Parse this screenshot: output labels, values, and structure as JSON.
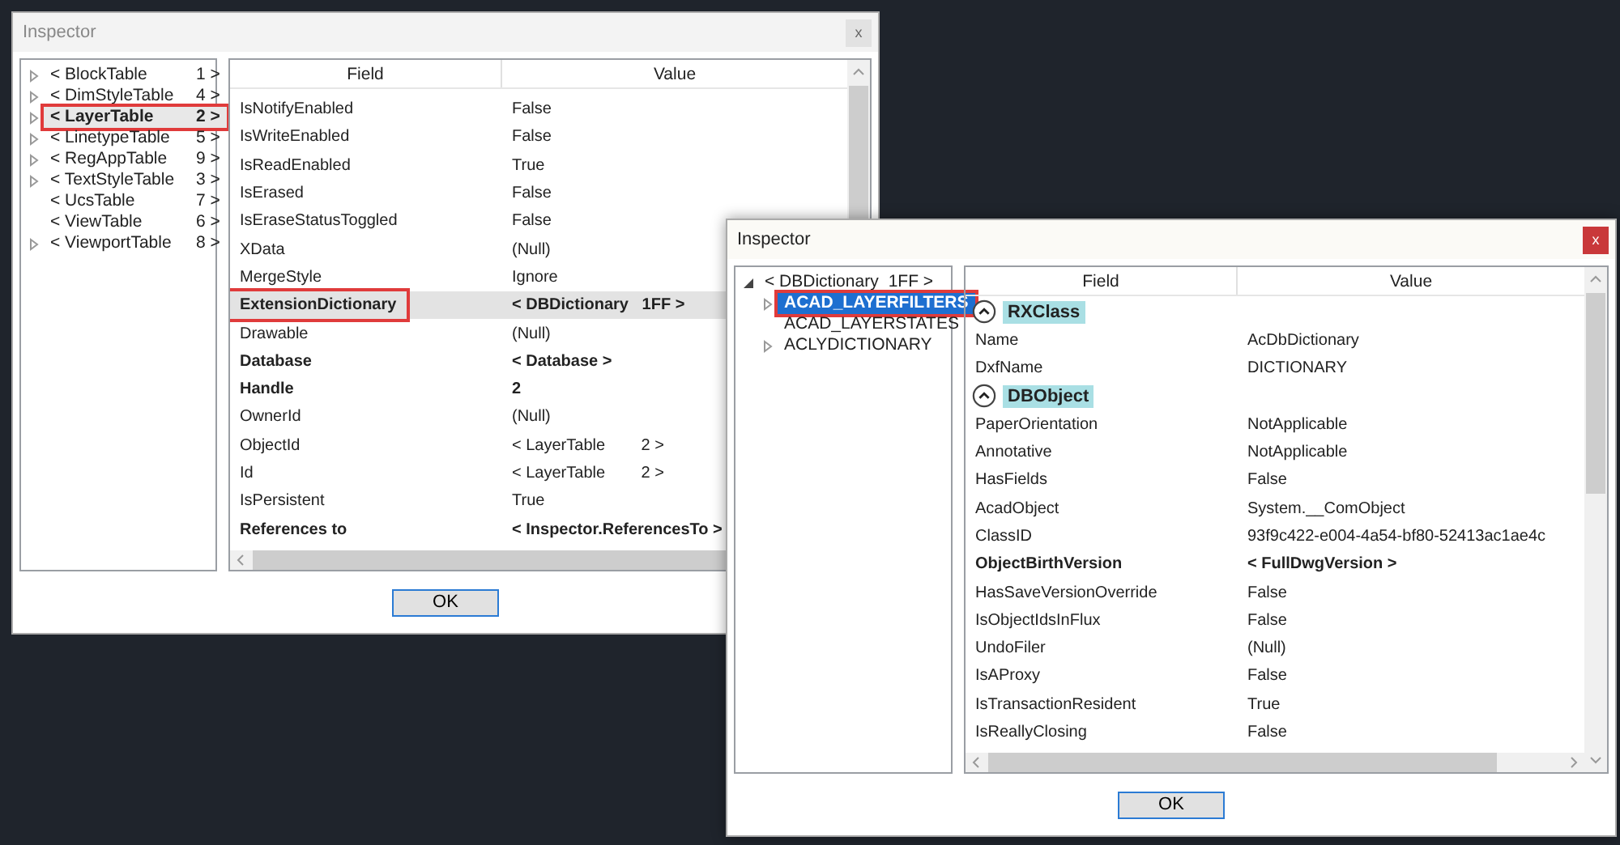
{
  "windows": [
    {
      "title": "Inspector",
      "close": "x",
      "active": false,
      "tree": [
        {
          "label": "< BlockTable",
          "count": "1 >",
          "expandable": true,
          "selected": false,
          "highlighted": false
        },
        {
          "label": "< DimStyleTable",
          "count": "4 >",
          "expandable": true,
          "selected": false,
          "highlighted": false
        },
        {
          "label": "< LayerTable",
          "count": "2 >",
          "expandable": true,
          "selected": true,
          "highlighted": true
        },
        {
          "label": "< LinetypeTable",
          "count": "5 >",
          "expandable": true,
          "selected": false,
          "highlighted": false
        },
        {
          "label": "< RegAppTable",
          "count": "9 >",
          "expandable": true,
          "selected": false,
          "highlighted": false
        },
        {
          "label": "< TextStyleTable",
          "count": "3 >",
          "expandable": true,
          "selected": false,
          "highlighted": false
        },
        {
          "label": "< UcsTable",
          "count": "7 >",
          "expandable": false,
          "selected": false,
          "highlighted": false
        },
        {
          "label": "< ViewTable",
          "count": "6 >",
          "expandable": false,
          "selected": false,
          "highlighted": false
        },
        {
          "label": "< ViewportTable",
          "count": "8 >",
          "expandable": true,
          "selected": false,
          "highlighted": false
        }
      ],
      "columns": [
        "Field",
        "Value"
      ],
      "rows": [
        {
          "kind": "property",
          "field": "IsNotifyEnabled",
          "value": "False",
          "bold": false,
          "selected": false,
          "highlighted": false
        },
        {
          "kind": "property",
          "field": "IsWriteEnabled",
          "value": "False",
          "bold": false,
          "selected": false,
          "highlighted": false
        },
        {
          "kind": "property",
          "field": "IsReadEnabled",
          "value": "True",
          "bold": false,
          "selected": false,
          "highlighted": false
        },
        {
          "kind": "property",
          "field": "IsErased",
          "value": "False",
          "bold": false,
          "selected": false,
          "highlighted": false
        },
        {
          "kind": "property",
          "field": "IsEraseStatusToggled",
          "value": "False",
          "bold": false,
          "selected": false,
          "highlighted": false
        },
        {
          "kind": "property",
          "field": "XData",
          "value": "(Null)",
          "bold": false,
          "selected": false,
          "highlighted": false
        },
        {
          "kind": "property",
          "field": "MergeStyle",
          "value": "Ignore",
          "bold": false,
          "selected": false,
          "highlighted": false
        },
        {
          "kind": "property",
          "field": "ExtensionDictionary",
          "value": "< DBDictionary   1FF >",
          "bold": true,
          "selected": true,
          "highlighted": true
        },
        {
          "kind": "property",
          "field": "Drawable",
          "value": "(Null)",
          "bold": false,
          "selected": false,
          "highlighted": false
        },
        {
          "kind": "property",
          "field": "Database",
          "value": "< Database >",
          "bold": true,
          "selected": false,
          "highlighted": false
        },
        {
          "kind": "property",
          "field": "Handle",
          "value": "2",
          "bold": true,
          "selected": false,
          "highlighted": false
        },
        {
          "kind": "property",
          "field": "OwnerId",
          "value": "(Null)",
          "bold": false,
          "selected": false,
          "highlighted": false
        },
        {
          "kind": "property",
          "field": "ObjectId",
          "value": "< LayerTable        2 >",
          "bold": false,
          "selected": false,
          "highlighted": false
        },
        {
          "kind": "property",
          "field": "Id",
          "value": "< LayerTable        2 >",
          "bold": false,
          "selected": false,
          "highlighted": false
        },
        {
          "kind": "property",
          "field": "IsPersistent",
          "value": "True",
          "bold": false,
          "selected": false,
          "highlighted": false
        },
        {
          "kind": "property",
          "field": "References to",
          "value": "< Inspector.ReferencesTo >",
          "bold": true,
          "selected": false,
          "highlighted": false
        }
      ],
      "ok": "OK"
    },
    {
      "title": "Inspector",
      "close": "x",
      "active": true,
      "tree": [
        {
          "label": "< DBDictionary",
          "count": "1FF >",
          "expandable": true,
          "expanded": true,
          "selected": false,
          "highlighted": false,
          "children": [
            {
              "label": "ACAD_LAYERFILTERS",
              "expandable": true,
              "selected": true,
              "highlighted": true
            },
            {
              "label": "ACAD_LAYERSTATES",
              "expandable": false,
              "selected": false,
              "highlighted": false
            },
            {
              "label": "ACLYDICTIONARY",
              "expandable": true,
              "selected": false,
              "highlighted": false
            }
          ]
        }
      ],
      "columns": [
        "Field",
        "Value"
      ],
      "rows": [
        {
          "kind": "section",
          "field": "RXClass"
        },
        {
          "kind": "property",
          "field": "Name",
          "value": "AcDbDictionary",
          "bold": false,
          "selected": false,
          "highlighted": false
        },
        {
          "kind": "property",
          "field": "DxfName",
          "value": "DICTIONARY",
          "bold": false,
          "selected": false,
          "highlighted": false
        },
        {
          "kind": "section",
          "field": "DBObject"
        },
        {
          "kind": "property",
          "field": "PaperOrientation",
          "value": "NotApplicable",
          "bold": false,
          "selected": false,
          "highlighted": false
        },
        {
          "kind": "property",
          "field": "Annotative",
          "value": "NotApplicable",
          "bold": false,
          "selected": false,
          "highlighted": false
        },
        {
          "kind": "property",
          "field": "HasFields",
          "value": "False",
          "bold": false,
          "selected": false,
          "highlighted": false
        },
        {
          "kind": "property",
          "field": "AcadObject",
          "value": "System.__ComObject",
          "bold": false,
          "selected": false,
          "highlighted": false
        },
        {
          "kind": "property",
          "field": "ClassID",
          "value": "93f9c422-e004-4a54-bf80-52413ac1ae4c",
          "bold": false,
          "selected": false,
          "highlighted": false
        },
        {
          "kind": "property",
          "field": "ObjectBirthVersion",
          "value": "< FullDwgVersion >",
          "bold": true,
          "selected": false,
          "highlighted": false
        },
        {
          "kind": "property",
          "field": "HasSaveVersionOverride",
          "value": "False",
          "bold": false,
          "selected": false,
          "highlighted": false
        },
        {
          "kind": "property",
          "field": "IsObjectIdsInFlux",
          "value": "False",
          "bold": false,
          "selected": false,
          "highlighted": false
        },
        {
          "kind": "property",
          "field": "UndoFiler",
          "value": "(Null)",
          "bold": false,
          "selected": false,
          "highlighted": false
        },
        {
          "kind": "property",
          "field": "IsAProxy",
          "value": "False",
          "bold": false,
          "selected": false,
          "highlighted": false
        },
        {
          "kind": "property",
          "field": "IsTransactionResident",
          "value": "True",
          "bold": false,
          "selected": false,
          "highlighted": false
        },
        {
          "kind": "property",
          "field": "IsReallyClosing",
          "value": "False",
          "bold": false,
          "selected": false,
          "highlighted": false
        }
      ],
      "ok": "OK"
    }
  ]
}
